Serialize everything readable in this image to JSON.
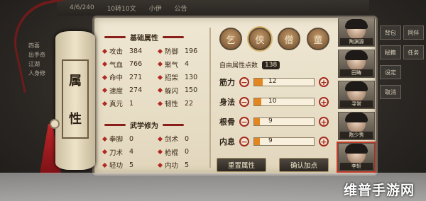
{
  "topbar": {
    "items": [
      "4/6/240",
      "10转10文",
      "小伊",
      "公告"
    ]
  },
  "left_text": [
    "四喜",
    "出手奇",
    "江湖",
    "人身修"
  ],
  "right_menu": [
    "背包",
    "同伴",
    "秘籍",
    "任务",
    "设定",
    "取消"
  ],
  "scroll": {
    "char1": "属",
    "char2": "性"
  },
  "basic": {
    "title": "基础属性",
    "stats": [
      {
        "label": "攻击",
        "value": "384"
      },
      {
        "label": "防御",
        "value": "196"
      },
      {
        "label": "气血",
        "value": "766"
      },
      {
        "label": "聚气",
        "value": "4"
      },
      {
        "label": "命中",
        "value": "271"
      },
      {
        "label": "招架",
        "value": "130"
      },
      {
        "label": "速度",
        "value": "274"
      },
      {
        "label": "躲闪",
        "value": "150"
      },
      {
        "label": "真元",
        "value": "1"
      },
      {
        "label": "韧性",
        "value": "22"
      }
    ]
  },
  "martial": {
    "title": "武学修为",
    "stats": [
      {
        "label": "拳脚",
        "value": "0"
      },
      {
        "label": "剑术",
        "value": "0"
      },
      {
        "label": "刀术",
        "value": "4"
      },
      {
        "label": "枪棍",
        "value": "0"
      },
      {
        "label": "轻功",
        "value": "5"
      },
      {
        "label": "内功",
        "value": "5"
      }
    ]
  },
  "portraits": [
    "乞",
    "侠",
    "僧",
    "童"
  ],
  "free_points": {
    "label": "自由属性点数",
    "value": "138"
  },
  "attributes": [
    {
      "name": "筋力",
      "value": "12",
      "fill": 0.14
    },
    {
      "name": "身法",
      "value": "10",
      "fill": 0.12
    },
    {
      "name": "根骨",
      "value": "9",
      "fill": 0.1
    },
    {
      "name": "内息",
      "value": "9",
      "fill": 0.1
    }
  ],
  "buttons": {
    "reset": "重置属性",
    "confirm": "确认加点"
  },
  "roster": [
    "陶渊源",
    "田畴",
    "寻常",
    "陈少秀",
    "李轩"
  ],
  "watermark": "维普手游网"
}
